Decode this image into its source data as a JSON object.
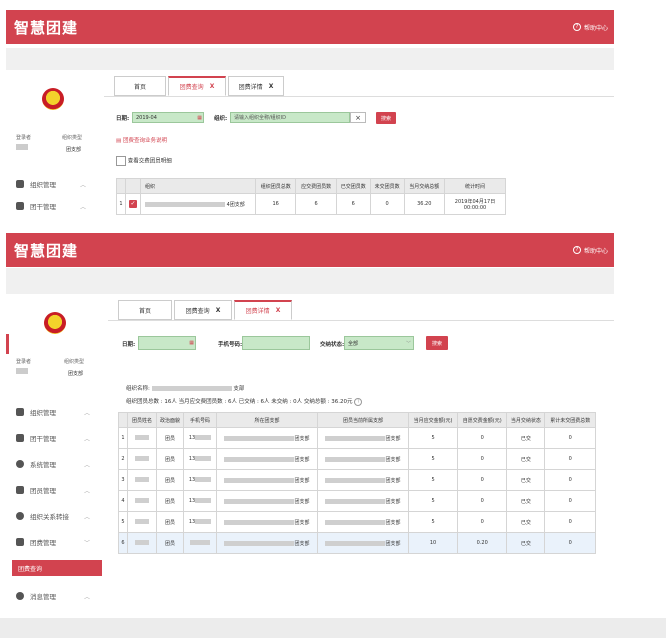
{
  "app": {
    "title": "智慧团建",
    "help": "帮助中心"
  },
  "tabs_top": [
    {
      "label": "首页"
    },
    {
      "label": "团费查询"
    },
    {
      "label": "团费详情"
    }
  ],
  "query_top": {
    "date_label": "日期:",
    "date_value": "2019-04",
    "org_label": "组织:",
    "org_placeholder": "请输入组织全称/组织ID",
    "search": "搜索",
    "notice": "团费查询业务说明",
    "export": "查看交费团员明细"
  },
  "table_top": {
    "headers": [
      "",
      "",
      "组织",
      "组织团员总数",
      "应交费团员数",
      "已交团员数",
      "未交团员数",
      "当月交纳总额",
      "统计时间"
    ],
    "row": {
      "index": "1",
      "org_suffix": "4团支部",
      "total": "16",
      "due": "6",
      "paid": "6",
      "unpaid": "0",
      "sum": "36.20",
      "time": "2019年04月17日 00:00:00"
    }
  },
  "sidebar": {
    "logon": "登录者",
    "org_type": "组织类型",
    "org_value": "团支部",
    "menu": [
      {
        "label": "组织管理"
      },
      {
        "label": "团干管理"
      },
      {
        "label": "系统管理"
      },
      {
        "label": "团员管理"
      },
      {
        "label": "组织关系转接"
      },
      {
        "label": "团费管理"
      },
      {
        "label": "团费查询"
      },
      {
        "label": "消息管理"
      }
    ]
  },
  "tabs_bottom": [
    {
      "label": "首页"
    },
    {
      "label": "团费查询"
    },
    {
      "label": "团费详情"
    }
  ],
  "query_bottom": {
    "date_label": "日期:",
    "phone_label": "手机号码:",
    "status_label": "交纳状态:",
    "status_value": "全部",
    "search": "搜索"
  },
  "summary": {
    "org_name_label": "组织名称:",
    "org_name_suffix": "支部",
    "stats": "组织团员总数 : 16人  当月应交费团员数 : 6人  已交纳 : 6人  未交纳 : 0人  交纳总额 : 36.20元"
  },
  "table_bottom": {
    "headers": [
      "",
      "团员姓名",
      "政治面貌",
      "手机号码",
      "所在团支部",
      "团员当前所属支部",
      "当月应交金额(元)",
      "自愿交费金额(元)",
      "当月交纳状态",
      "累计未交团费总数"
    ],
    "rows": [
      {
        "i": "1",
        "status": "团员",
        "phone": "13",
        "branch": "团支部",
        "cur": "团支部",
        "due": "5",
        "vol": "0",
        "paid": "已交",
        "arrears": "0"
      },
      {
        "i": "2",
        "status": "团员",
        "phone": "13",
        "branch": "团支部",
        "cur": "团支部",
        "due": "5",
        "vol": "0",
        "paid": "已交",
        "arrears": "0"
      },
      {
        "i": "3",
        "status": "团员",
        "phone": "13",
        "branch": "团支部",
        "cur": "团支部",
        "due": "5",
        "vol": "0",
        "paid": "已交",
        "arrears": "0"
      },
      {
        "i": "4",
        "status": "团员",
        "phone": "13",
        "branch": "团支部",
        "cur": "团支部",
        "due": "5",
        "vol": "0",
        "paid": "已交",
        "arrears": "0"
      },
      {
        "i": "5",
        "status": "团员",
        "phone": "13",
        "branch": "团支部",
        "cur": "团支部",
        "due": "5",
        "vol": "0",
        "paid": "已交",
        "arrears": "0"
      },
      {
        "i": "6",
        "status": "团员",
        "phone": "",
        "branch": "团支部",
        "cur": "团支部",
        "due": "10",
        "vol": "0.20",
        "paid": "已交",
        "arrears": "0"
      }
    ]
  }
}
